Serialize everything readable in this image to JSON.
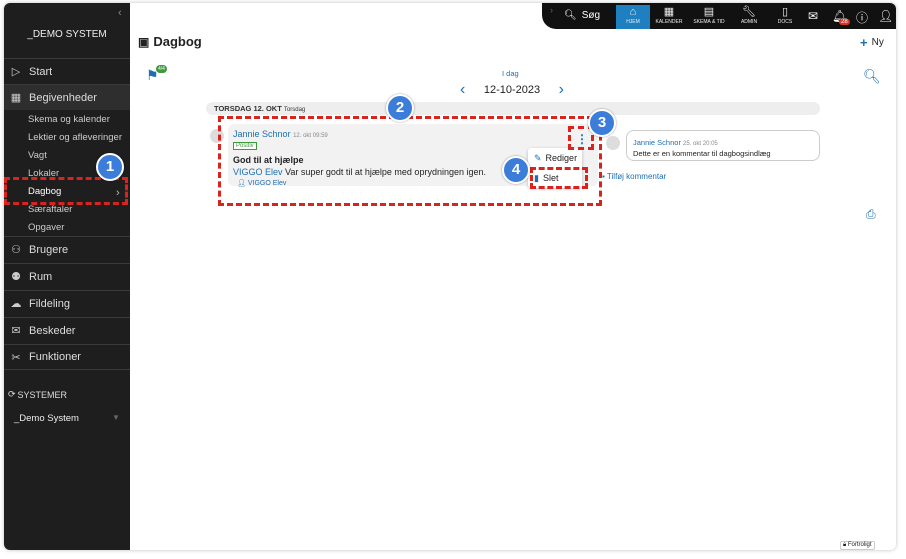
{
  "sidebar": {
    "logo": "_DEMO SYSTEM",
    "items": [
      {
        "label": "Start"
      },
      {
        "label": "Begivenheder"
      },
      {
        "label": "Brugere"
      },
      {
        "label": "Rum"
      },
      {
        "label": "Fildeling"
      },
      {
        "label": "Beskeder"
      },
      {
        "label": "Funktioner"
      }
    ],
    "subitems": [
      "Skema og kalender",
      "Lektier og afleveringer",
      "Vagt",
      "Lokaler",
      "Dagbog",
      "Særaftaler",
      "Opgaver"
    ],
    "systemer_label": "SYSTEMER",
    "system_name": "_Demo System"
  },
  "topbar": {
    "search_label": "Søg",
    "buttons": [
      "HJEM",
      "KALENDER",
      "SKEMA & TID",
      "ADMIN",
      "DOCS"
    ],
    "notification_count": "28"
  },
  "header": {
    "title": "Dagbog",
    "new_label": "Ny"
  },
  "nav": {
    "flag_badge": "4/4",
    "today_label": "I dag",
    "date": "12-10-2023"
  },
  "day": {
    "label": "TORSDAG 12. OKT",
    "sub": "Torsdag"
  },
  "entry": {
    "author": "Jannie Schnor",
    "timestamp": "12. okt 09:59",
    "tag": "Positiv",
    "title": "God til at hjælpe",
    "student_name": "VIGGO Elev",
    "text": "Var super godt til at hjælpe med oprydningen igen.",
    "student_ref": "VIGGO Elev",
    "menu": {
      "edit": "Rediger",
      "delete": "Slet"
    }
  },
  "comment": {
    "author": "Jannie Schnor",
    "timestamp": "25. okt 20:05",
    "text": "Dette er en kommentar til dagbogsindlæg",
    "add_label": "Tilføj kommentar"
  },
  "footer": {
    "confidential": "Fortroligt"
  },
  "annotations": [
    "1",
    "2",
    "3",
    "4"
  ],
  "colors": {
    "accent": "#1e6fb0",
    "sidebar_bg": "#1e1e1e",
    "annotation_red": "#d9231d",
    "annotation_blue": "#3b7dd8",
    "positive_green": "#3c9a3c"
  }
}
